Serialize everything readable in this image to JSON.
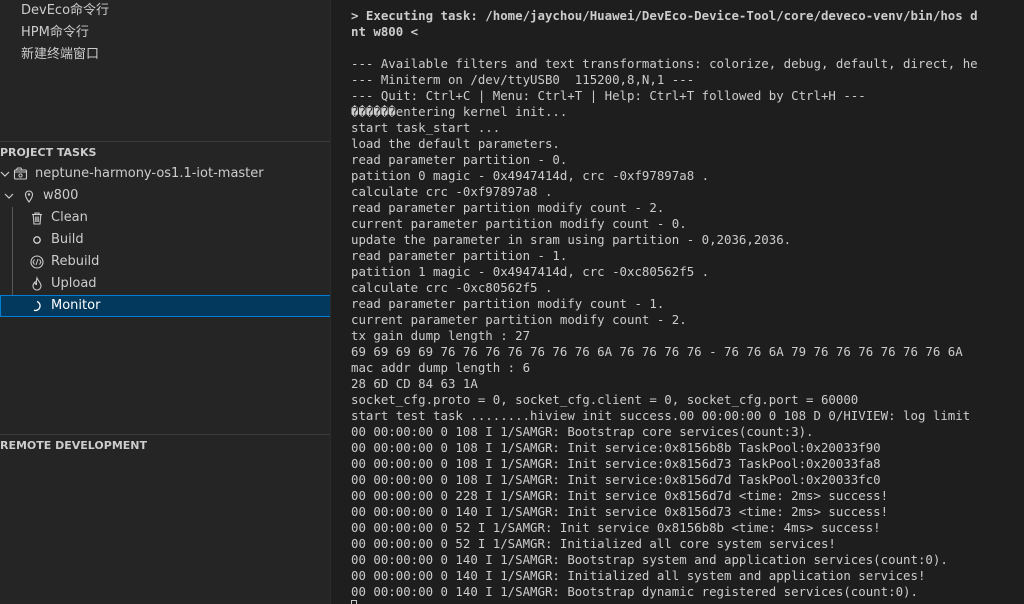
{
  "sidebar": {
    "commands": [
      "DevEco命令行",
      "HPM命令行",
      "新建终端窗口"
    ],
    "project_tasks": {
      "header": "PROJECT TASKS",
      "project": {
        "label": "neptune-harmony-os1.1-iot-master",
        "chevron": "expanded"
      },
      "device": {
        "label": "w800",
        "chevron": "expanded"
      },
      "tasks": [
        {
          "label": "Clean",
          "icon": "trash-icon"
        },
        {
          "label": "Build",
          "icon": "circle-icon"
        },
        {
          "label": "Rebuild",
          "icon": "rebuild-icon"
        },
        {
          "label": "Upload",
          "icon": "flame-icon"
        },
        {
          "label": "Monitor",
          "icon": "loading-spinner-icon",
          "selected": true
        }
      ]
    },
    "remote_development": {
      "header": "REMOTE DEVELOPMENT"
    }
  },
  "terminal": {
    "lines": [
      {
        "text": "> Executing task: /home/jaychou/Huawei/DevEco-Device-Tool/core/deveco-venv/bin/hos d",
        "bold": true
      },
      {
        "text": "nt w800 <",
        "bold": true
      },
      {
        "text": ""
      },
      {
        "text": "--- Available filters and text transformations: colorize, debug, default, direct, he"
      },
      {
        "text": "--- Miniterm on /dev/ttyUSB0  115200,8,N,1 ---"
      },
      {
        "text": "--- Quit: Ctrl+C | Menu: Ctrl+T | Help: Ctrl+T followed by Ctrl+H ---"
      },
      {
        "text": "������entering kernel init..."
      },
      {
        "text": "start task_start ..."
      },
      {
        "text": "load the default parameters."
      },
      {
        "text": "read parameter partition - 0."
      },
      {
        "text": "patition 0 magic - 0x4947414d, crc -0xf97897a8 ."
      },
      {
        "text": "calculate crc -0xf97897a8 ."
      },
      {
        "text": "read parameter partition modify count - 2."
      },
      {
        "text": "current parameter partition modify count - 0."
      },
      {
        "text": "update the parameter in sram using partition - 0,2036,2036."
      },
      {
        "text": "read parameter partition - 1."
      },
      {
        "text": "patition 1 magic - 0x4947414d, crc -0xc80562f5 ."
      },
      {
        "text": "calculate crc -0xc80562f5 ."
      },
      {
        "text": "read parameter partition modify count - 1."
      },
      {
        "text": "current parameter partition modify count - 2."
      },
      {
        "text": "tx gain dump length : 27"
      },
      {
        "text": "69 69 69 69 76 76 76 76 76 76 76 6A 76 76 76 76 - 76 76 6A 79 76 76 76 76 76 76 6A"
      },
      {
        "text": "mac addr dump length : 6"
      },
      {
        "text": "28 6D CD 84 63 1A"
      },
      {
        "text": "socket_cfg.proto = 0, socket_cfg.client = 0, socket_cfg.port = 60000"
      },
      {
        "text": "start test task ........hiview init success.00 00:00:00 0 108 D 0/HIVIEW: log limit"
      },
      {
        "text": "00 00:00:00 0 108 I 1/SAMGR: Bootstrap core services(count:3)."
      },
      {
        "text": "00 00:00:00 0 108 I 1/SAMGR: Init service:0x8156b8b TaskPool:0x20033f90"
      },
      {
        "text": "00 00:00:00 0 108 I 1/SAMGR: Init service:0x8156d73 TaskPool:0x20033fa8"
      },
      {
        "text": "00 00:00:00 0 108 I 1/SAMGR: Init service:0x8156d7d TaskPool:0x20033fc0"
      },
      {
        "text": "00 00:00:00 0 228 I 1/SAMGR: Init service 0x8156d7d <time: 2ms> success!"
      },
      {
        "text": "00 00:00:00 0 140 I 1/SAMGR: Init service 0x8156d73 <time: 2ms> success!"
      },
      {
        "text": "00 00:00:00 0 52 I 1/SAMGR: Init service 0x8156b8b <time: 4ms> success!"
      },
      {
        "text": "00 00:00:00 0 52 I 1/SAMGR: Initialized all core system services!"
      },
      {
        "text": "00 00:00:00 0 140 I 1/SAMGR: Bootstrap system and application services(count:0)."
      },
      {
        "text": "00 00:00:00 0 140 I 1/SAMGR: Initialized all system and application services!"
      },
      {
        "text": "00 00:00:00 0 140 I 1/SAMGR: Bootstrap dynamic registered services(count:0)."
      }
    ]
  }
}
